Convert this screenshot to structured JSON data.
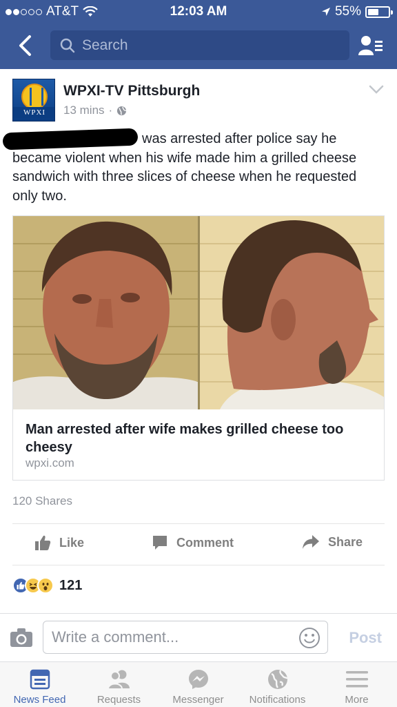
{
  "status_bar": {
    "carrier": "AT&T",
    "time": "12:03 AM",
    "battery": "55%",
    "battery_level": 0.55
  },
  "nav": {
    "search_placeholder": "Search"
  },
  "post": {
    "page_name": "WPXI-TV Pittsburgh",
    "avatar_text": "WPXI",
    "time_ago": "13 mins",
    "separator": "·",
    "text": "was arrested after police say he became violent when his wife made him a grilled cheese sandwich with three slices of cheese when he requested only two.",
    "link": {
      "title": "Man arrested after wife makes grilled cheese too cheesy",
      "domain": "wpxi.com"
    },
    "shares": "120 Shares",
    "actions": {
      "like": "Like",
      "comment": "Comment",
      "share": "Share"
    },
    "reactions_count": "121"
  },
  "comment_bar": {
    "placeholder": "Write a comment...",
    "post_label": "Post"
  },
  "tabs": [
    {
      "label": "News Feed",
      "icon": "news-feed-icon",
      "active": true
    },
    {
      "label": "Requests",
      "icon": "requests-icon"
    },
    {
      "label": "Messenger",
      "icon": "messenger-icon"
    },
    {
      "label": "Notifications",
      "icon": "globe-icon"
    },
    {
      "label": "More",
      "icon": "hamburger-icon"
    }
  ],
  "colors": {
    "brand": "#3b5998",
    "active_tab": "#4267b2"
  }
}
